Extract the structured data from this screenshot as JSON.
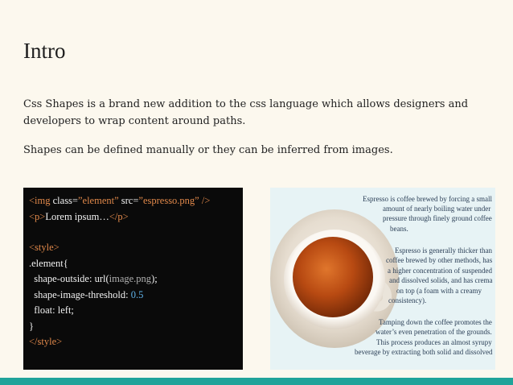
{
  "slide": {
    "title": "Intro",
    "paragraph1_line1": "Css Shapes is a brand new addition to the css language which allows designers and",
    "paragraph1_line2": "developers to wrap content around paths.",
    "paragraph2": "Shapes can be defined manually or they can be inferred from images."
  },
  "code": {
    "line1": {
      "open": "<img",
      "class_attr": " class=",
      "class_val": "”element”",
      "src_attr": " src=",
      "src_val": "”espresso.png”",
      "close": " />"
    },
    "line2": {
      "open": "<p>",
      "text": "Lorem ipsum…",
      "close": "</p>"
    },
    "line3": {
      "tag": "<style>"
    },
    "line4": {
      "text": ".element{"
    },
    "line5": {
      "prop": "  shape-outside: url(",
      "arg": "image.png",
      "end": ");"
    },
    "line6": {
      "prop": "  shape-image-threshold: ",
      "value": "0.5"
    },
    "line7": {
      "text": "  float: left;"
    },
    "line8": {
      "text": "}"
    },
    "line9": {
      "tag": "</style>"
    }
  },
  "image_text": {
    "lines": [
      "Espresso is coffee brewed by forcing a small",
      "amount of nearly boiling water under",
      "pressure through finely ground coffee",
      "beans.",
      "Espresso is generally thicker than",
      "coffee brewed by other methods, has",
      "a higher concentration of suspended",
      "and dissolved solids, and has crema",
      "on top (a foam with a creamy",
      "consistency).",
      "Tamping down the coffee promotes the",
      "water’s even penetration of the grounds.",
      "This process produces an almost syrupy",
      "beverage by extracting both solid and dissolved"
    ]
  },
  "colors": {
    "background": "#fcf8ee",
    "accent_bar": "#20a39a",
    "code_background": "#0a0a0a",
    "code_tag": "#e0884a",
    "code_number": "#5fb2e8",
    "image_text": "#2a3e56"
  }
}
